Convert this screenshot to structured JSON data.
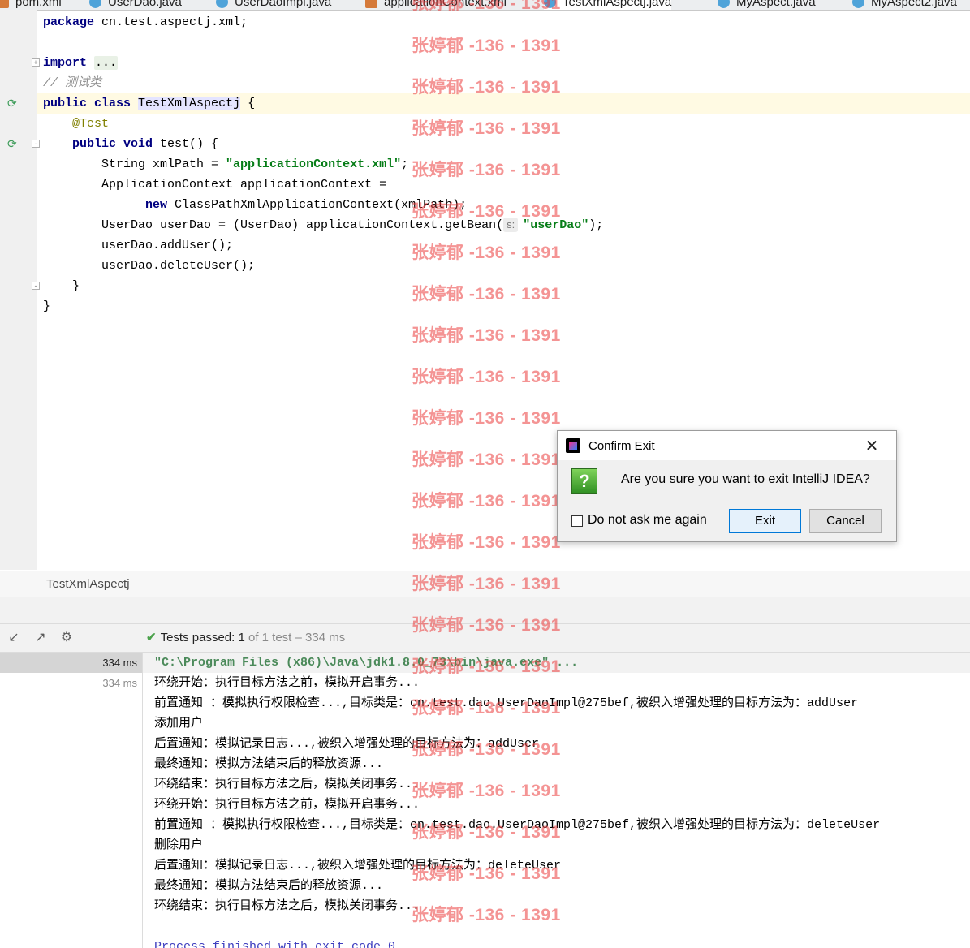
{
  "tabs": [
    {
      "label": "pom.xml",
      "icon": "xml-file-icon"
    },
    {
      "label": "UserDao.java",
      "icon": "interface-icon"
    },
    {
      "label": "UserDaoImpl.java",
      "icon": "class-icon"
    },
    {
      "label": "applicationContext.xml",
      "icon": "xml-file-icon"
    },
    {
      "label": "TestXmlAspectj.java",
      "icon": "class-icon",
      "active": true
    },
    {
      "label": "MyAspect.java",
      "icon": "class-icon"
    },
    {
      "label": "MyAspect2.java",
      "icon": "class-icon"
    }
  ],
  "code": {
    "l1_kw": "package",
    "l1_rest": " cn.test.aspectj.xml;",
    "l3_kw": "import",
    "l3_dots": "...",
    "l4_comment": "// 测试类",
    "l5_kw": "public class",
    "l5_cls": "TestXmlAspectj",
    "l5_rest": " {",
    "l6_ann": "@Test",
    "l7_kw": "public void",
    "l7_rest": " test() {",
    "l8_a": "String xmlPath = ",
    "l8_str": "\"applicationContext.xml\"",
    "l8_b": ";",
    "l9": "ApplicationContext applicationContext =",
    "l10_kw": "new",
    "l10_rest": " ClassPathXmlApplicationContext(xmlPath);",
    "l11_a": "UserDao userDao = (UserDao) applicationContext.getBean(",
    "l11_hint": "s:",
    "l11_str": "\"userDao\"",
    "l11_b": ");",
    "l12": "userDao.addUser();",
    "l13": "userDao.deleteUser();",
    "l14": "}",
    "l15": "}"
  },
  "breadcrumb": "TestXmlAspectj",
  "run": {
    "status_prefix": "Tests passed:",
    "status_count": "1",
    "status_rest": "of 1 test – 334 ms",
    "tree": [
      "334 ms",
      "334 ms"
    ],
    "console": [
      "\"C:\\Program Files (x86)\\Java\\jdk1.8.0_73\\bin\\java.exe\" ...",
      "环绕开始：执行目标方法之前，模拟开启事务...",
      "前置通知 ：模拟执行权限检查...,目标类是：cn.test.dao.UserDaoImpl@275bef,被织入增强处理的目标方法为：addUser",
      "添加用户",
      "后置通知：模拟记录日志...,被织入增强处理的目标方法为：addUser",
      "最终通知：模拟方法结束后的释放资源...",
      "环绕结束：执行目标方法之后，模拟关闭事务...",
      "环绕开始：执行目标方法之前，模拟开启事务...",
      "前置通知 ：模拟执行权限检查...,目标类是：cn.test.dao.UserDaoImpl@275bef,被织入增强处理的目标方法为：deleteUser",
      "删除用户",
      "后置通知：模拟记录日志...,被织入增强处理的目标方法为：deleteUser",
      "最终通知：模拟方法结束后的释放资源...",
      "环绕结束：执行目标方法之后，模拟关闭事务...",
      "",
      "Process finished with exit code 0"
    ]
  },
  "watermark": "张婷郁 -136 - 1391",
  "dialog": {
    "title": "Confirm Exit",
    "message": "Are you sure you want to exit IntelliJ IDEA?",
    "checkbox_label": "Do not ask me again",
    "exit_label": "Exit",
    "cancel_label": "Cancel"
  }
}
